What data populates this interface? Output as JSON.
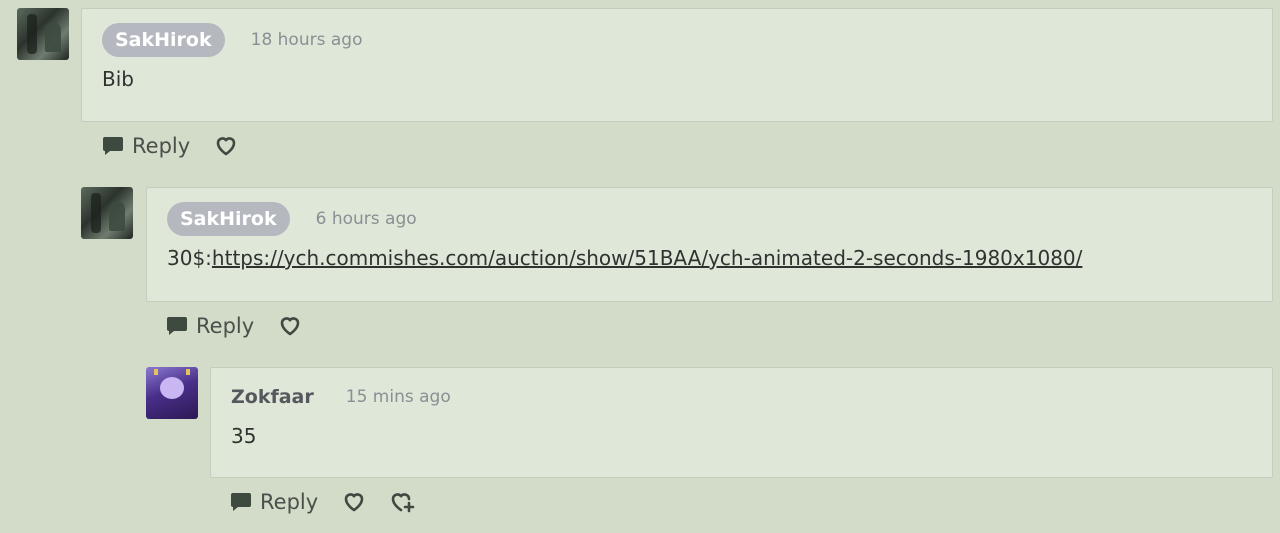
{
  "comments": [
    {
      "author": "SakHirok",
      "time": "18 hours ago",
      "text": "Bib",
      "reply_label": "Reply"
    },
    {
      "author": "SakHirok",
      "time": "6 hours ago",
      "text_prefix": "30$:",
      "link": "https://ych.commishes.com/auction/show/51BAA/ych-animated-2-seconds-1980x1080/",
      "reply_label": "Reply"
    },
    {
      "author": "Zokfaar",
      "time": "15 mins ago",
      "text": "35",
      "reply_label": "Reply"
    }
  ],
  "icons": {
    "reply": "speech-bubble-icon",
    "like": "heart-outline-icon",
    "add_like": "heart-plus-icon"
  },
  "colors": {
    "background": "#d2dcc9",
    "card": "#dfe7d9",
    "name_pill": "#b5b9bf",
    "action": "#3e4a40"
  }
}
